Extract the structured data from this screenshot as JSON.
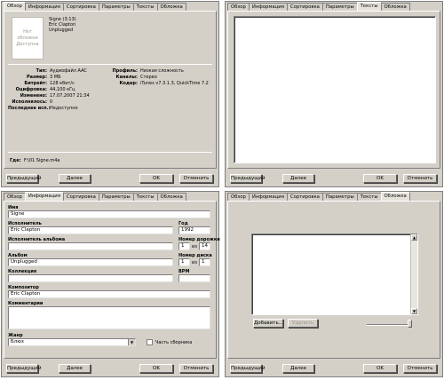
{
  "tabs": [
    "Обзор",
    "Информация",
    "Сортировка",
    "Параметры",
    "Тексты",
    "Обложка"
  ],
  "buttons": {
    "prev": "Предыдущий",
    "next": "Далее",
    "ok": "OK",
    "cancel": "Отменить",
    "add": "Добавить...",
    "remove": "Удалить"
  },
  "summary": {
    "art_placeholder": "Нет обложки Доступна",
    "track_title": "Signe (3:13)",
    "artist": "Eric Clapton",
    "album": "Unplugged",
    "left_fields": [
      {
        "label": "Тип:",
        "value": "Аудиофайл AAC"
      },
      {
        "label": "Размер:",
        "value": "3 МБ"
      },
      {
        "label": "Битрейт:",
        "value": "128 кбит/с"
      },
      {
        "label": "Оцифровка:",
        "value": "44,100 кГц"
      },
      {
        "label": "Изменено:",
        "value": "17.07.2007 21:34"
      },
      {
        "label": "Исполнялось:",
        "value": "0"
      },
      {
        "label": "Последнее исп.:",
        "value": "Недоступно"
      }
    ],
    "right_fields": [
      {
        "label": "Профиль:",
        "value": "Низкая сложность"
      },
      {
        "label": "Каналы:",
        "value": "Стерео"
      },
      {
        "label": "Кодер:",
        "value": "iTunes v7.3.1.3, QuickTime 7.2"
      }
    ],
    "where_label": "Где:",
    "where_value": "F:\\01 Signe.m4a"
  },
  "info": {
    "name_label": "Имя",
    "name": "Signe",
    "artist_label": "Исполнитель",
    "artist": "Eric Clapton",
    "year_label": "Год",
    "year": "1992",
    "album_artist_label": "Исполнитель альбома",
    "album_artist": "",
    "track_number_label": "Номер дорожки",
    "track_number": "1",
    "track_total": "14",
    "album_label": "Альбом",
    "album": "Unplugged",
    "disc_number_label": "Номер диска",
    "disc_number": "1",
    "disc_total": "1",
    "of_word": "из",
    "grouping_label": "Коллекция",
    "grouping": "",
    "bpm_label": "BPM",
    "bpm": "",
    "composer_label": "Композитор",
    "composer": "Eric Clapton",
    "comments_label": "Комментарии",
    "comments": "",
    "genre_label": "Жанр",
    "genre": "Блюз",
    "compilation_label": "Часть сборника"
  }
}
